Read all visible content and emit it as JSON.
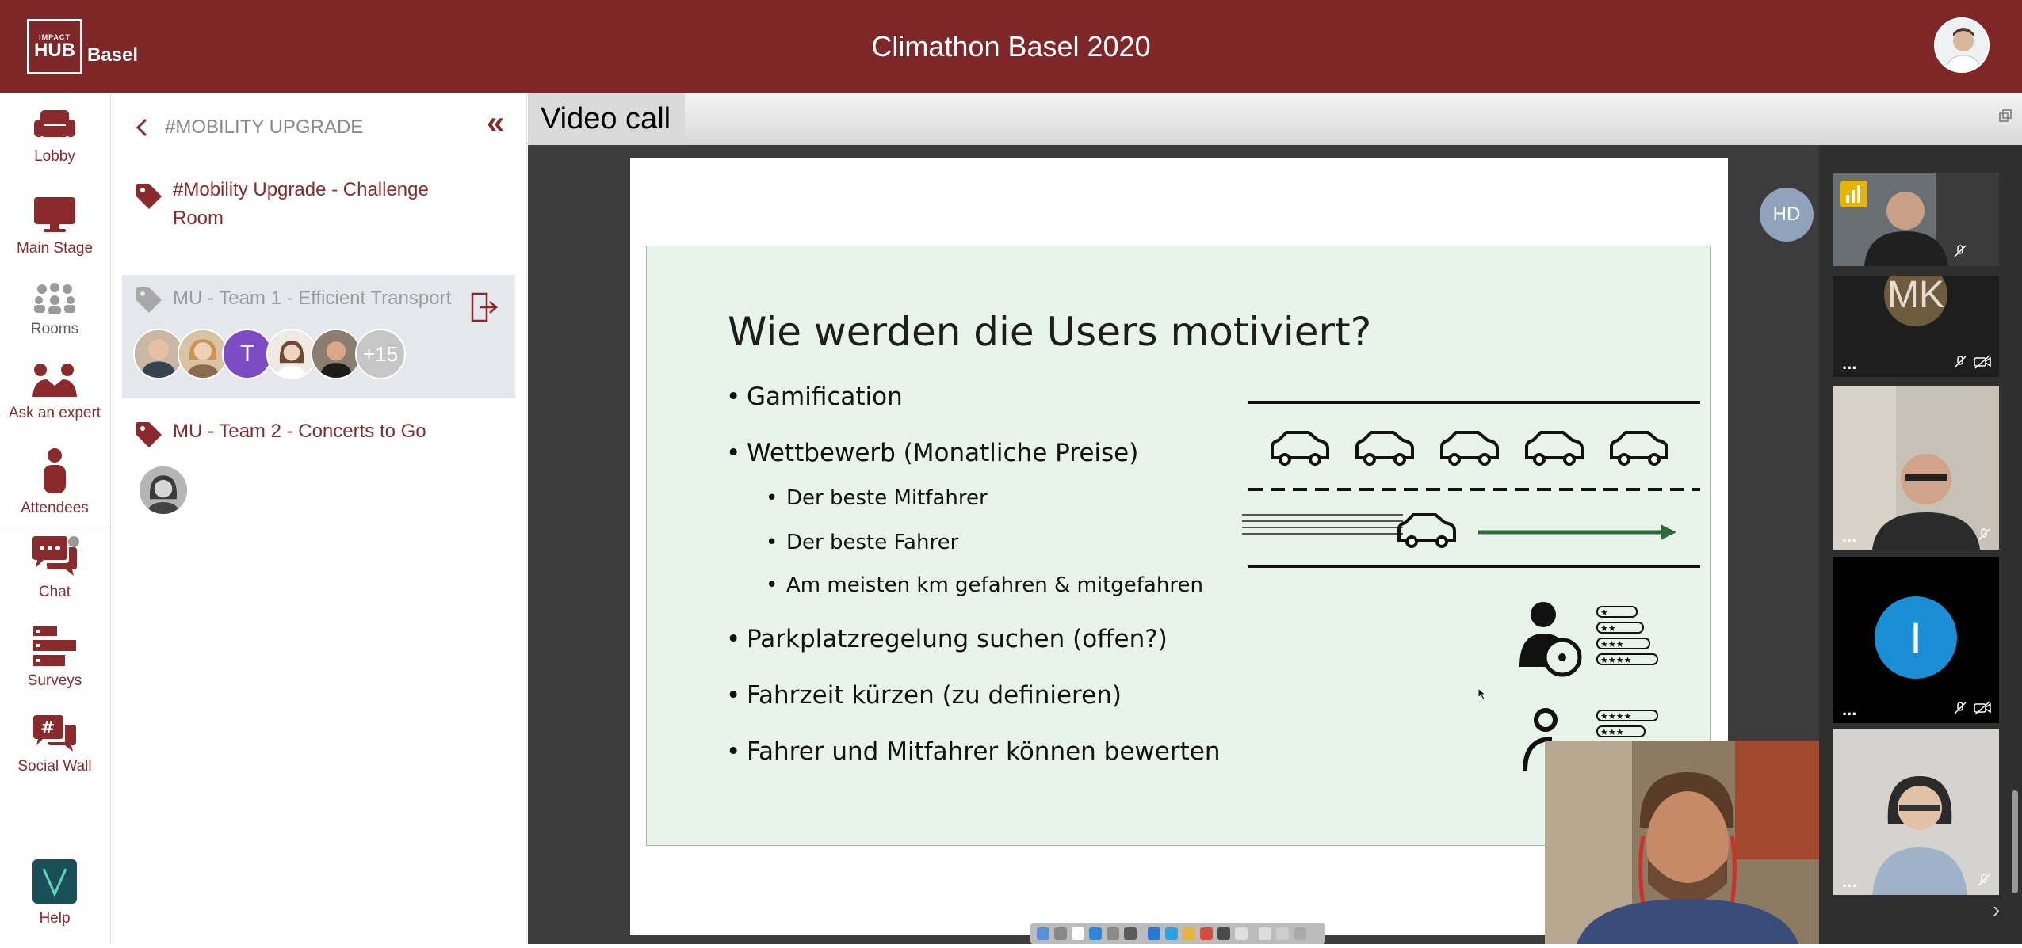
{
  "header": {
    "logo_small": "IMPACT",
    "logo_big": "HUB",
    "logo_city": "Basel",
    "title": "Climathon Basel 2020"
  },
  "nav": [
    {
      "label": "Lobby",
      "icon": "sofa-icon"
    },
    {
      "label": "Main Stage",
      "icon": "monitor-icon"
    },
    {
      "label": "Rooms",
      "icon": "people-group-icon",
      "active": true
    },
    {
      "label": "Ask an expert",
      "icon": "expert-icon"
    },
    {
      "label": "Attendees",
      "icon": "person-icon"
    },
    {
      "label": "Chat",
      "icon": "chat-bubbles-icon"
    },
    {
      "label": "Surveys",
      "icon": "survey-bars-icon"
    },
    {
      "label": "Social Wall",
      "icon": "hashtag-bubble-icon"
    },
    {
      "label": "Help",
      "icon": "help-logo-icon",
      "logo_letter": "V"
    }
  ],
  "rooms_panel": {
    "title": "#MOBILITY UPGRADE",
    "collapse_glyph": "«",
    "rooms": [
      {
        "label": "#Mobility Upgrade - Challenge Room"
      },
      {
        "label": "MU - Team 1 - Efficient Transport",
        "selected": true,
        "avatar_letter": "T",
        "more_count": "+15"
      },
      {
        "label": "MU - Team 2 - Concerts to Go"
      }
    ]
  },
  "video_call": {
    "tab_label": "Video call",
    "hd_badge": "HD",
    "tile_initials_mk": "MK",
    "tile_initial_i": "I",
    "tile_menu": "...",
    "colors": {
      "header": "#7e2628",
      "accent": "#8a2a2d",
      "tile_blue": "#1a8fd6"
    }
  },
  "slide": {
    "title": "Wie werden die Users motiviert?",
    "bullets": [
      "Gamification",
      "Wettbewerb (Monatliche Preise)",
      "Der beste Mitfahrer",
      "Der beste Fahrer",
      "Am meisten km gefahren & mitgefahren",
      "Parkplatzregelung suchen (offen?)",
      "Fahrzeit kürzen (zu definieren)",
      "Fahrer und Mitfahrer können bewerten"
    ]
  }
}
